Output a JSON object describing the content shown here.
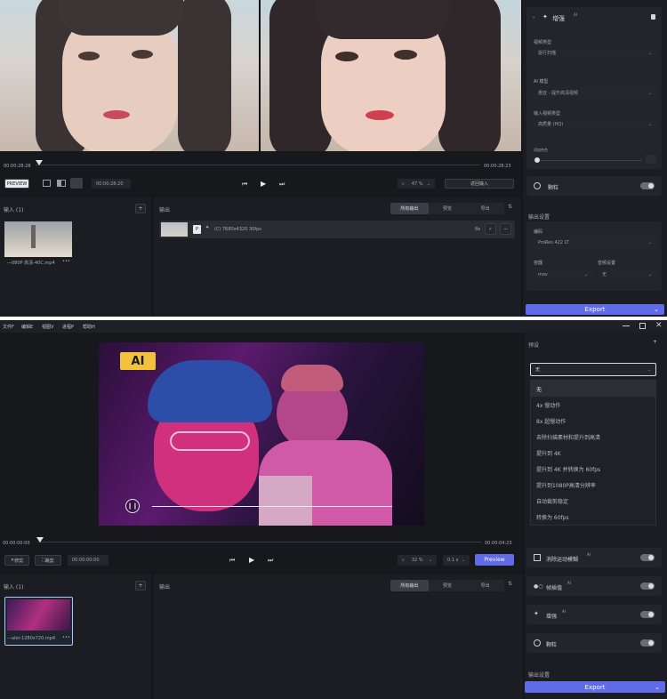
{
  "top": {
    "timeline": {
      "time_start": "00:00:28:28",
      "time_end": "00:00:28:23",
      "playhead_fraction": 0.08
    },
    "controls": {
      "preview_btn": "PREVIEW",
      "time": "00:00:28:20",
      "zoom": "47 %",
      "back_btn": "返回输入"
    },
    "input": {
      "title": "输入 (1)",
      "file": "—080P 高清-40C.mp4"
    },
    "output": {
      "title": "输出",
      "tabs": [
        "所有输出",
        "预览",
        "导出"
      ],
      "row": {
        "badge": "P",
        "text": "(C) 7680x4320 30fps",
        "mult": "8x"
      }
    },
    "sidebar": {
      "enhance_title": "增强",
      "enhance_sup": "AI",
      "video_type_label": "视频类型",
      "video_type_value": "逐行扫描",
      "ai_model_label": "AI 模型",
      "ai_model_value": "惠亚 - 提升高清视频",
      "input_quality_label": "输入视频类型",
      "input_quality_value": "高质量 (HQ)",
      "noise_label": "添加杂色",
      "grain_label": "颗粒",
      "output_settings": "输出设置",
      "codec_label": "编码",
      "codec_value": "ProRes 422 LT",
      "container_label": "容器",
      "container_value": "mov",
      "audio_label": "音频设置",
      "audio_value": "无",
      "export_btn": "Export"
    }
  },
  "bottom": {
    "menu": [
      "文件F",
      "编辑E",
      "视图V",
      "进程P",
      "帮助H"
    ],
    "ai_badge": "AI",
    "timeline": {
      "time_start": "00:00:00:00",
      "time_end": "00:00:04:23",
      "playhead_fraction": 0.0
    },
    "controls": {
      "crop_btn": "修剪",
      "trim_btn": "裁剪",
      "time": "00:00:00:00",
      "zoom": "32 %",
      "speed": "0.1 x",
      "preview_btn": "Preview"
    },
    "input": {
      "title": "输入 (1)",
      "file": "—aler-1280x720.mp4"
    },
    "output": {
      "title": "输出",
      "tabs": [
        "所有输出",
        "预览",
        "导出"
      ]
    },
    "sidebar": {
      "preset_label": "预设",
      "preset_value": "无",
      "dropdown": [
        "无",
        "4x 慢动作",
        "8x 超慢动作",
        "去除扫描素材和提升到高清",
        "提升到 4K",
        "提升到 4K 并转换为 60fps",
        "提升到1080P高清分辨率",
        "自动裁剪稳定",
        "转换为 60fps"
      ],
      "motion_blur": "消除运动模糊",
      "frame_interp": "帧插值",
      "enhance": "增强",
      "grain": "颗粒",
      "output_settings": "输出设置",
      "export_btn": "Export",
      "sup": "AI"
    }
  },
  "colors": {
    "accent": "#5f6be8",
    "panel": "#1b1d22",
    "ai_badge": "#f2c23c"
  }
}
